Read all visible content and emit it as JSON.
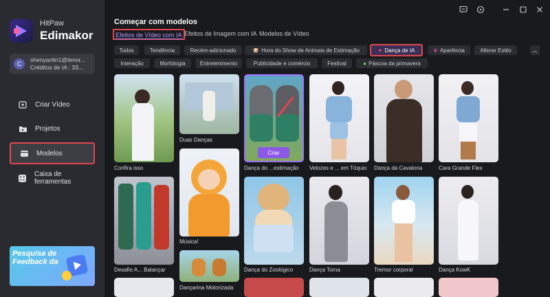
{
  "app": {
    "brand_small": "HitPaw",
    "brand_large": "Edimakor"
  },
  "account": {
    "avatar_letter": "C",
    "email": "shenyanlin1@tenor...",
    "credits": "Créditos de IA : 33..."
  },
  "nav": [
    {
      "label": "Criar Vídeo",
      "icon": "add-video-icon"
    },
    {
      "label": "Projetos",
      "icon": "folder-icon"
    },
    {
      "label": "Modelos",
      "icon": "templates-icon",
      "active": true
    },
    {
      "label": "Caixa de ferramentas",
      "icon": "toolbox-icon"
    }
  ],
  "feedback": {
    "text": "Pesquisa de Feedback da"
  },
  "main": {
    "title": "Começar com modelos",
    "tabs": [
      "Efeitos de Vídeo com IA",
      "Efeitos de Imagem com IA",
      "Modelos de Vídeo"
    ],
    "chips_row1": [
      "Todos",
      "Tendência",
      "Recém-adicionado",
      "Hora do Show de Animais de Estimação",
      "Dança de IA",
      "Aparência",
      "Alterar Estilo"
    ],
    "chips_row2": [
      "Interação",
      "Morfologia",
      "Entretenimento",
      "Publicidade e comércio",
      "Festival",
      "Páscoa da primavera"
    ],
    "create_label": "Criar",
    "captions": {
      "c1": "Confira isso",
      "c2": "Duas Danças",
      "c3": "Dança do ...estimação",
      "c4": "Velozes e ... em Tóquio",
      "c5": "Dança da Cavalona",
      "c6": "Cara Grande Flex",
      "c7": "Desafio A... Balançar",
      "c8": "Música!",
      "c9": "Dança do Zoológico",
      "c10": "Dança Toma",
      "c11": "Tremor corporal",
      "c12": "Dança KowK",
      "c13": "Dançarina Motorizada"
    }
  },
  "colors": {
    "accent": "#8c59e6",
    "highlight": "#e0484e",
    "sidebar": "#2a2b30",
    "bg": "#191a1e"
  }
}
